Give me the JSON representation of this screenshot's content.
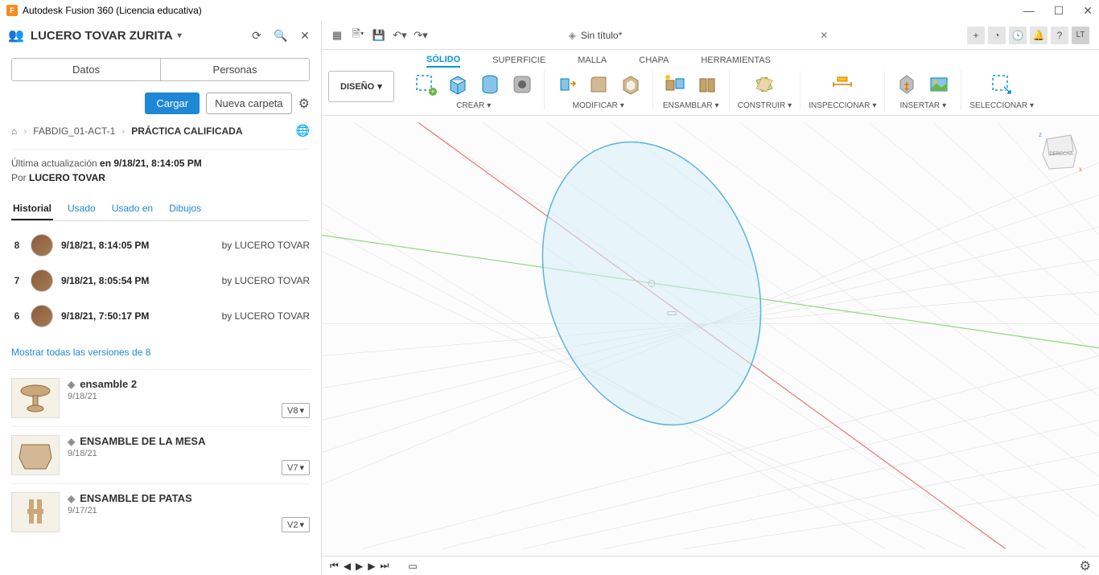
{
  "titlebar": {
    "app_name": "Autodesk Fusion 360 (Licencia educativa)"
  },
  "panel": {
    "username": "LUCERO TOVAR ZURITA",
    "tabs": {
      "data": "Datos",
      "people": "Personas"
    },
    "load_btn": "Cargar",
    "new_folder_btn": "Nueva carpeta",
    "breadcrumb": {
      "p1": "FABDIG_01-ACT-1",
      "p2": "PRÁCTICA CALIFICADA"
    },
    "info": {
      "last_update_prefix": "Última actualización ",
      "last_update_time": "en 9/18/21, 8:14:05 PM",
      "by_prefix": "Por ",
      "by_user": "LUCERO TOVAR"
    },
    "sub_tabs": {
      "history": "Historial",
      "used": "Usado",
      "used_in": "Usado en",
      "drawings": "Dibujos"
    },
    "history": [
      {
        "n": "8",
        "date": "9/18/21, 8:14:05 PM",
        "by": "by LUCERO TOVAR"
      },
      {
        "n": "7",
        "date": "9/18/21, 8:05:54 PM",
        "by": "by LUCERO TOVAR"
      },
      {
        "n": "6",
        "date": "9/18/21, 7:50:17 PM",
        "by": "by LUCERO TOVAR"
      }
    ],
    "show_all": "Mostrar todas las versiones de 8",
    "files": [
      {
        "name": "ensamble 2",
        "date": "9/18/21",
        "ver": "V8"
      },
      {
        "name": "ENSAMBLE DE LA MESA",
        "date": "9/18/21",
        "ver": "V7"
      },
      {
        "name": "ENSAMBLE DE PATAS",
        "date": "9/17/21",
        "ver": "V2"
      }
    ]
  },
  "doc": {
    "title": "Sin título*"
  },
  "workspace": {
    "design": "DISEÑO",
    "tabs": {
      "solid": "SÓLIDO",
      "surface": "SUPERFICIE",
      "mesh": "MALLA",
      "sheet": "CHAPA",
      "tools": "HERRAMIENTAS"
    },
    "groups": {
      "create": "CREAR",
      "modify": "MODIFICAR",
      "assemble": "ENSAMBLAR",
      "build": "CONSTRUIR",
      "inspect": "INSPECCIONAR",
      "insert": "INSERTAR",
      "select": "SELECCIONAR"
    }
  },
  "user_initials": "LT",
  "viewcube": {
    "face": "DERECHA"
  }
}
